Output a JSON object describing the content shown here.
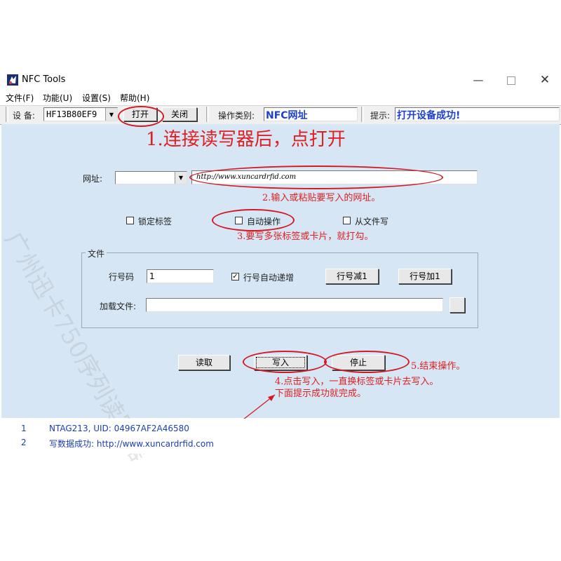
{
  "window": {
    "title": "NFC Tools"
  },
  "menu": [
    "文件(F)",
    "功能(U)",
    "设置(S)",
    "帮助(H)"
  ],
  "toolbar": {
    "device_label": "设  备:",
    "device_value": "HF13B80EF9",
    "open_label": "打开",
    "close_label": "关闭",
    "op_type_label": "操作类别:",
    "op_type_value": "NFC网址",
    "hint_label": "提示:",
    "hint_value": "打开设备成功!"
  },
  "form": {
    "url_label": "网址:",
    "url_value": "http://www.xuncardrfid.com",
    "lock_label": "锁定标签",
    "auto_label": "自动操作",
    "from_file_label": "从文件写",
    "group_title": "文件",
    "line_no_label": "行号码",
    "line_no_value": "1",
    "auto_inc_label": "行号自动递增",
    "auto_inc_checked": true,
    "dec_button": "行号减1",
    "inc_button": "行号加1",
    "load_file_label": "加载文件:",
    "read_button": "读取",
    "write_button": "写入",
    "stop_button": "停止"
  },
  "annotations": {
    "a1": "1.连接读写器后，点打开",
    "a2": "2.输入或粘贴要写入的网址。",
    "a3": "3.要写多张标签或卡片，就打勾。",
    "a4_line1": "4.点击写入，一直换标签或卡片去写入。",
    "a4_line2": "下面提示成功就完成。",
    "a5": "5.结束操作。",
    "color": "#e02020"
  },
  "watermark": "广州迅卡750序列读写器",
  "log": [
    {
      "index": "1",
      "text": "NTAG213, UID: 04967AF2A46580"
    },
    {
      "index": "2",
      "text": "写数据成功: http://www.xuncardrfid.com"
    }
  ]
}
